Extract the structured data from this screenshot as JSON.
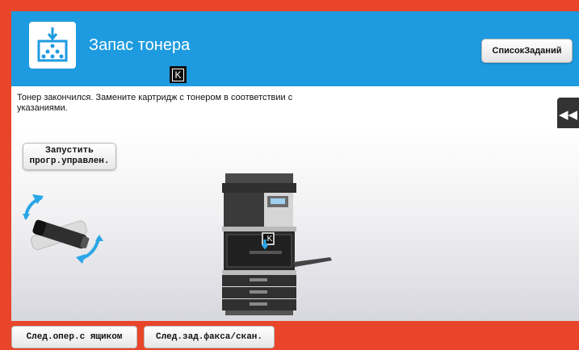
{
  "header": {
    "title": "Запас тонера",
    "toner_color": "K",
    "job_list_label": "СписокЗаданий",
    "icon": "toner-supply-icon"
  },
  "message": {
    "text": "Тонер закончился. Замените картридж с тонером в соответствии с указаниями."
  },
  "panel": {
    "collapse_icon": "double-chevron-left-icon",
    "run_program_label_line1": "Запустить",
    "run_program_label_line2": "прогр.управлен."
  },
  "illustration": {
    "printer_toner_label": "K"
  },
  "footer": {
    "next_op_tray_label": "След.опер.с ящиком",
    "next_job_fax_scan_label": "След.зад.факса/скан."
  },
  "colors": {
    "frame": "#e8452a",
    "header": "#1e9be0",
    "arrows": "#2aa6e6"
  }
}
